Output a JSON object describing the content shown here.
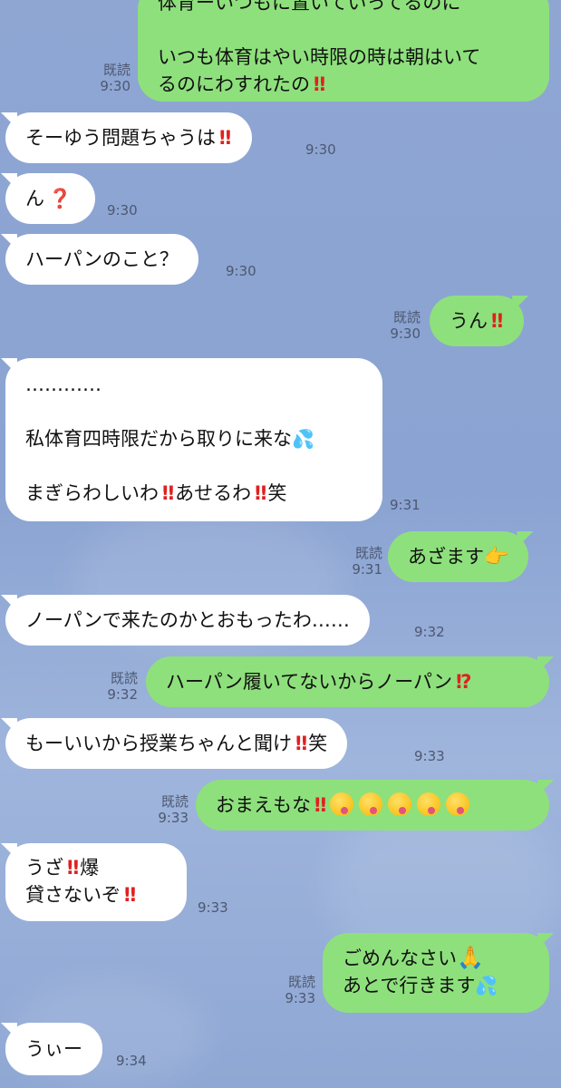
{
  "messages": [
    {
      "side": "out",
      "lines": [
        "体育ーいつもに置いていってるのに",
        "",
        "いつも体育はやい時限の時は朝はいて",
        "るのにわすれたの"
      ],
      "read": "既読",
      "time": "9:30"
    },
    {
      "side": "in",
      "text": "そーゆう問題ちゃうは",
      "time": "9:30"
    },
    {
      "side": "in",
      "text": "ん",
      "time": "9:30"
    },
    {
      "side": "in",
      "text": "ハーパンのこと？",
      "time": "9:30"
    },
    {
      "side": "out",
      "text": "うん",
      "read": "既読",
      "time": "9:30"
    },
    {
      "side": "in",
      "lines": [
        "…………",
        "",
        "私体育四時限だから取りに来な",
        "",
        "まぎらわしいわ",
        "あせるわ",
        "笑"
      ],
      "time": "9:31"
    },
    {
      "side": "out",
      "text": "あざます",
      "read": "既読",
      "time": "9:31"
    },
    {
      "side": "in",
      "text": "ノーパンで来たのかとおもったわ……",
      "time": "9:32"
    },
    {
      "side": "out",
      "text": "ハーパン履いてないからノーパン",
      "read": "既読",
      "time": "9:32"
    },
    {
      "side": "in",
      "text": "もーいいから授業ちゃんと聞け",
      "suffix": "笑",
      "time": "9:33"
    },
    {
      "side": "out",
      "text": "おまえもな",
      "read": "既読",
      "time": "9:33"
    },
    {
      "side": "in",
      "lines": [
        "うざ",
        "爆",
        "貸さないぞ"
      ],
      "time": "9:33"
    },
    {
      "side": "out",
      "lines": [
        "ごめんなさい",
        "あとで行きます"
      ],
      "read": "既読",
      "time": "9:33"
    },
    {
      "side": "in",
      "text": "うぃー",
      "time": "9:34"
    }
  ],
  "icons": {
    "double_exclamation": "‼",
    "red_question": "❓",
    "exclamation_question": "⁉",
    "sweat_drops": "💦",
    "folded_hands": "🙏",
    "zany_face": "🤪",
    "pointing": "👉"
  },
  "colors": {
    "background": "#8fa6d3",
    "incoming_bubble": "#ffffff",
    "outgoing_bubble": "#8ee07c",
    "meta_text": "#4d5870",
    "exclamation": "#e02020"
  }
}
